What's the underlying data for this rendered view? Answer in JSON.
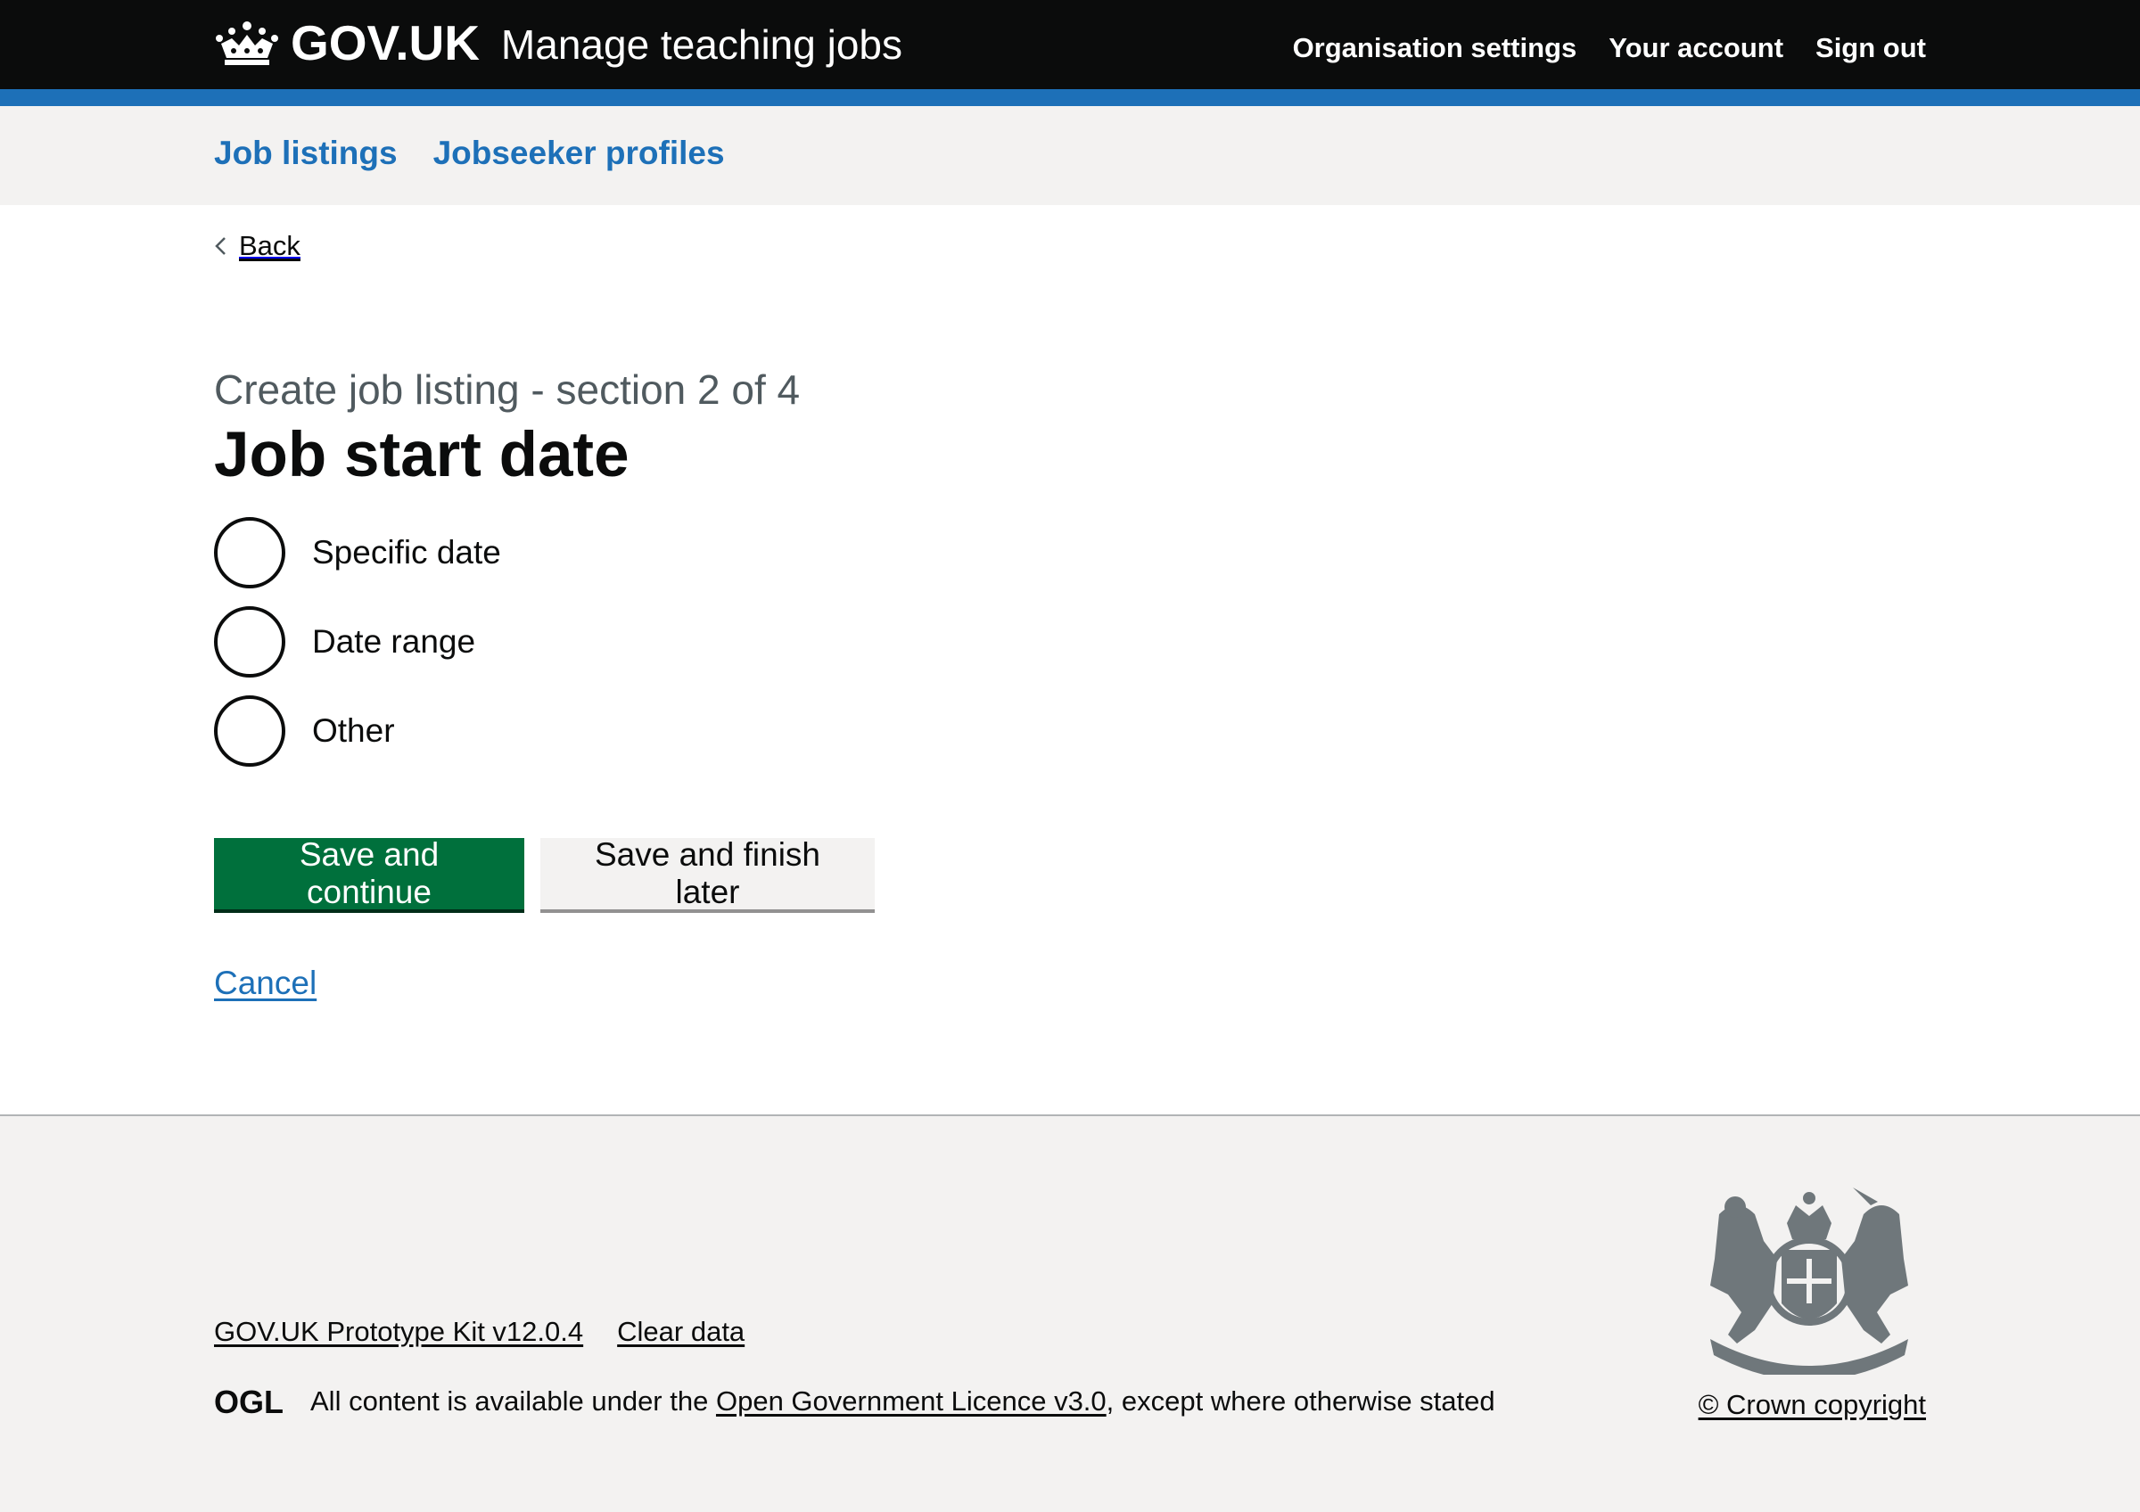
{
  "header": {
    "logo_text": "GOV.UK",
    "service_name": "Manage teaching jobs",
    "nav": [
      {
        "label": "Organisation settings"
      },
      {
        "label": "Your account"
      },
      {
        "label": "Sign out"
      }
    ],
    "accent_color": "#1d70b8"
  },
  "subnav": {
    "items": [
      {
        "label": "Job listings"
      },
      {
        "label": "Jobseeker profiles"
      }
    ]
  },
  "back": {
    "label": "Back"
  },
  "main": {
    "caption": "Create job listing - section 2 of 4",
    "heading": "Job start date",
    "options": [
      {
        "label": "Specific date",
        "checked": false
      },
      {
        "label": "Date range",
        "checked": false
      },
      {
        "label": "Other",
        "checked": false
      }
    ],
    "primary_button": "Save and continue",
    "secondary_button": "Save and finish later",
    "cancel": "Cancel"
  },
  "footer": {
    "links": [
      {
        "label": "GOV.UK Prototype Kit v12.0.4"
      },
      {
        "label": "Clear data"
      }
    ],
    "ogl_logo": "OGL",
    "licence_prefix": "All content is available under the",
    "licence_link": "Open Government Licence v3.0",
    "licence_suffix": ", except where otherwise stated",
    "copyright": "© Crown copyright"
  },
  "colors": {
    "primary_button": "#00703c",
    "link": "#1d70b8",
    "header_bg": "#0b0c0c",
    "footer_bg": "#f3f2f1"
  }
}
